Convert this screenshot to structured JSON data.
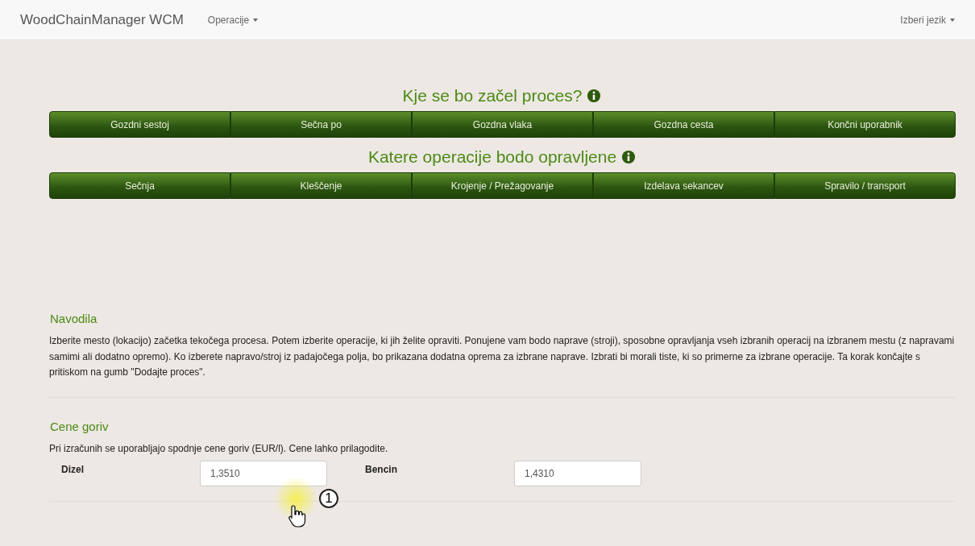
{
  "navbar": {
    "brand": "WoodChainManager WCM",
    "menu": "Operacije",
    "language": "Izberi jezik"
  },
  "sections": [
    {
      "title": "Kje se bo začel proces?",
      "options": [
        {
          "label": "Gozdni sestoj"
        },
        {
          "label": "Sečna po"
        },
        {
          "label": "Gozdna vlaka"
        },
        {
          "label": "Gozdna cesta"
        },
        {
          "label": "Končni uporabnik"
        }
      ]
    },
    {
      "title": "Katere operacije bodo opravljene",
      "options": [
        {
          "label": "Sečnja"
        },
        {
          "label": "Kleščenje"
        },
        {
          "label": "Krojenje / Prežagovanje"
        },
        {
          "label": "Izdelava sekancev"
        },
        {
          "label": "Spravilo / transport"
        }
      ]
    }
  ],
  "instructions": {
    "title": "Navodila",
    "text": "Izberite mesto (lokacijo) začetka tekočega procesa. Potem izberite operacije, ki jih želite opraviti. Ponujene vam bodo naprave (stroji), sposobne opravljanja vseh izbranih operacij na izbranem mestu (z napravami samimi ali dodatno opremo). Ko izberete napravo/stroj iz padajočega polja, bo prikazana dodatna oprema za izbrane naprave. Izbrati bi morali tiste, ki so primerne za izbrane operacije. Ta korak končajte s pritiskom na gumb \"Dodajte proces\"."
  },
  "fuel": {
    "title": "Cene goriv",
    "text": "Pri izračunih se uporabljajo spodnje cene goriv (EUR/l). Cene lahko prilagodite.",
    "fields": [
      {
        "label": "Dizel",
        "value": "1,3510"
      },
      {
        "label": "Bencin",
        "value": "1,4310"
      }
    ]
  },
  "cursor_marker": {
    "label": "1"
  }
}
